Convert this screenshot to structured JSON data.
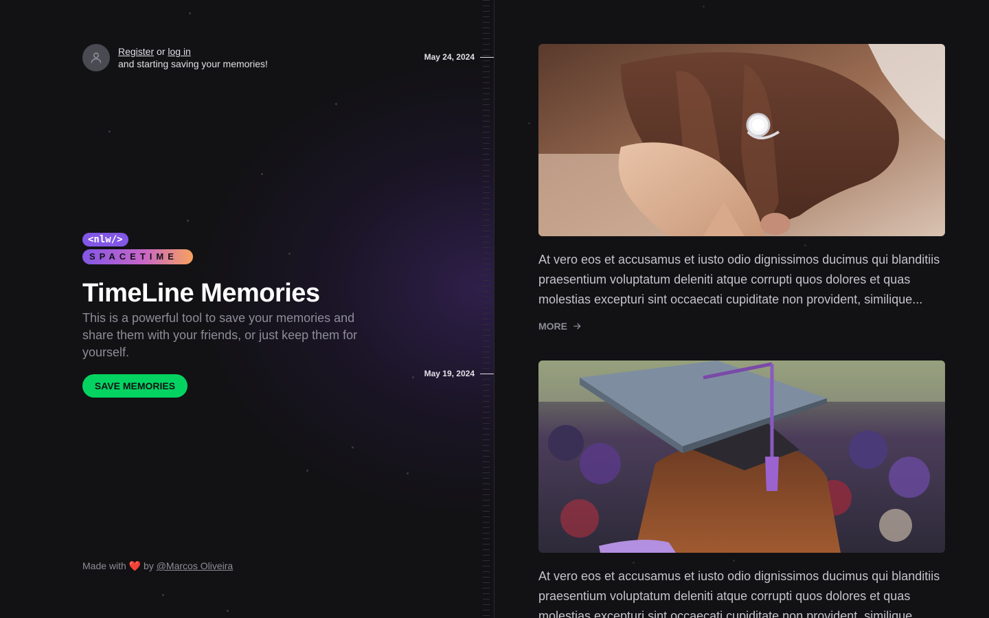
{
  "user": {
    "register_label": "Register",
    "or_text": "or",
    "login_label": "log in",
    "subtitle": "and starting saving your memories!"
  },
  "logo": {
    "nlw": "<nlw/>",
    "spacetime": "SPACETIME"
  },
  "hero": {
    "title": "TimeLine Memories",
    "description": "This is a powerful tool to save your memories and share them with your friends, or just keep them for yourself.",
    "cta_label": "SAVE MEMORIES"
  },
  "footer": {
    "made_with": "Made with",
    "by": "by",
    "author": "@Marcos Oliveira"
  },
  "timeline": {
    "dates": [
      "May 24, 2024",
      "May 19, 2024"
    ]
  },
  "memories": [
    {
      "image": "engagement-ring-photo",
      "excerpt": "At vero eos et accusamus et iusto odio dignissimos ducimus qui blanditiis praesentium voluptatum deleniti atque corrupti quos dolores et quas molestias excepturi sint occaecati cupiditate non provident, similique...",
      "more_label": "MORE"
    },
    {
      "image": "graduation-cap-photo",
      "excerpt": "At vero eos et accusamus et iusto odio dignissimos ducimus qui blanditiis praesentium voluptatum deleniti atque corrupti quos dolores et quas molestias excepturi sint occaecati cupiditate non provident, similique..."
    }
  ],
  "colors": {
    "background": "#121214",
    "accent_purple": "#8257e5",
    "cta_green": "#04d361",
    "text_muted": "#8d8d99"
  }
}
